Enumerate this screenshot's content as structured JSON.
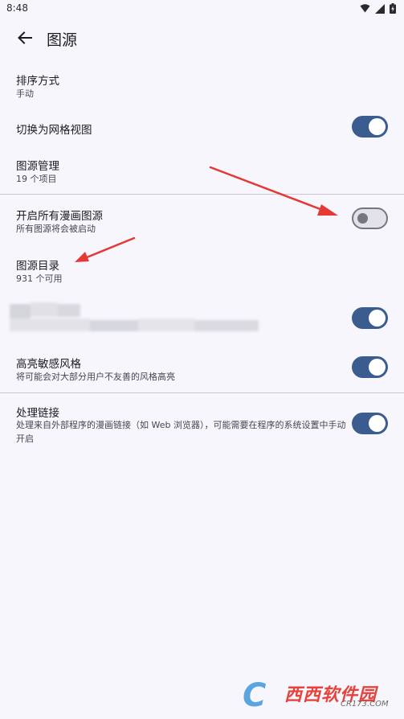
{
  "status_bar": {
    "time": "8:48",
    "icons": [
      "wifi-icon",
      "signal-icon",
      "battery-icon"
    ]
  },
  "app_bar": {
    "title": "图源",
    "back_icon": "arrow-left-icon"
  },
  "preferences": {
    "sort_order": {
      "title": "排序方式",
      "summary": "手动"
    },
    "grid_view": {
      "title": "切换为网格视图",
      "checked": true
    },
    "source_manage": {
      "title": "图源管理",
      "summary": "19 个项目"
    },
    "enable_all": {
      "title": "开启所有漫画图源",
      "summary": "所有图源将会被启动",
      "checked": false
    },
    "catalog": {
      "title": "图源目录",
      "summary": "931 个可用"
    },
    "blurred_item": {
      "checked": true
    },
    "highlight_nsfw": {
      "title": "高亮敏感风格",
      "summary": "将可能会对大部分用户不友善的风格高亮",
      "checked": true
    },
    "handle_links": {
      "title": "处理链接",
      "summary": "处理来自外部程序的漫画链接（如 Web 浏览器），可能需要在程序的系统设置中手动开启",
      "checked": true
    }
  },
  "colors": {
    "background": "#f7f6fd",
    "switch_on": "#3b5c8e",
    "switch_off_track": "#e3e2ea",
    "annotation_arrow": "#e53935"
  },
  "watermark": {
    "logo": "C",
    "brand": "西西软件园",
    "site": "CR173.COM"
  }
}
